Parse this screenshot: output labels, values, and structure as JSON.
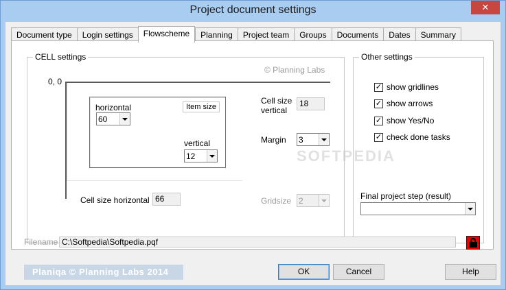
{
  "window": {
    "title": "Project document settings",
    "close_label": "✕"
  },
  "tabs": [
    {
      "label": "Document type"
    },
    {
      "label": "Login settings"
    },
    {
      "label": "Flowscheme"
    },
    {
      "label": "Planning"
    },
    {
      "label": "Project team"
    },
    {
      "label": "Groups"
    },
    {
      "label": "Documents"
    },
    {
      "label": "Dates"
    },
    {
      "label": "Summary"
    }
  ],
  "active_tab": "Flowscheme",
  "cell_settings": {
    "legend": "CELL settings",
    "copyright": "© Planning Labs",
    "origin_label": "0, 0",
    "horizontal_label": "horizontal",
    "horizontal_value": "60",
    "item_size_label": "Item size",
    "vertical_label": "vertical",
    "vertical_value": "12",
    "cell_size_vertical_label_1": "Cell size",
    "cell_size_vertical_label_2": "vertical",
    "cell_size_vertical_value": "18",
    "margin_label": "Margin",
    "margin_value": "3",
    "cell_size_horizontal_label": "Cell size horizontal",
    "cell_size_horizontal_value": "66",
    "gridsize_label": "Gridsize",
    "gridsize_value": "2"
  },
  "other_settings": {
    "legend": "Other settings",
    "checkboxes": [
      {
        "label": "show gridlines",
        "checked": true
      },
      {
        "label": "show arrows",
        "checked": true
      },
      {
        "label": "show Yes/No",
        "checked": true
      },
      {
        "label": "check done tasks",
        "checked": true
      }
    ],
    "final_step_label": "Final project step  (result)",
    "final_step_value": ""
  },
  "watermark": "SOFTPEDIA",
  "filename": {
    "label": "Filename",
    "value": "C:\\Softpedia\\Softpedia.pqf"
  },
  "lock_icon": "lock-icon",
  "footer": {
    "brand": "Planiqa     © Planning Labs 2014",
    "ok_label": "OK",
    "cancel_label": "Cancel",
    "help_label": "Help"
  },
  "colors": {
    "title_bar": "#a8cdf1",
    "close": "#c7463f",
    "lock": "#e60000"
  }
}
